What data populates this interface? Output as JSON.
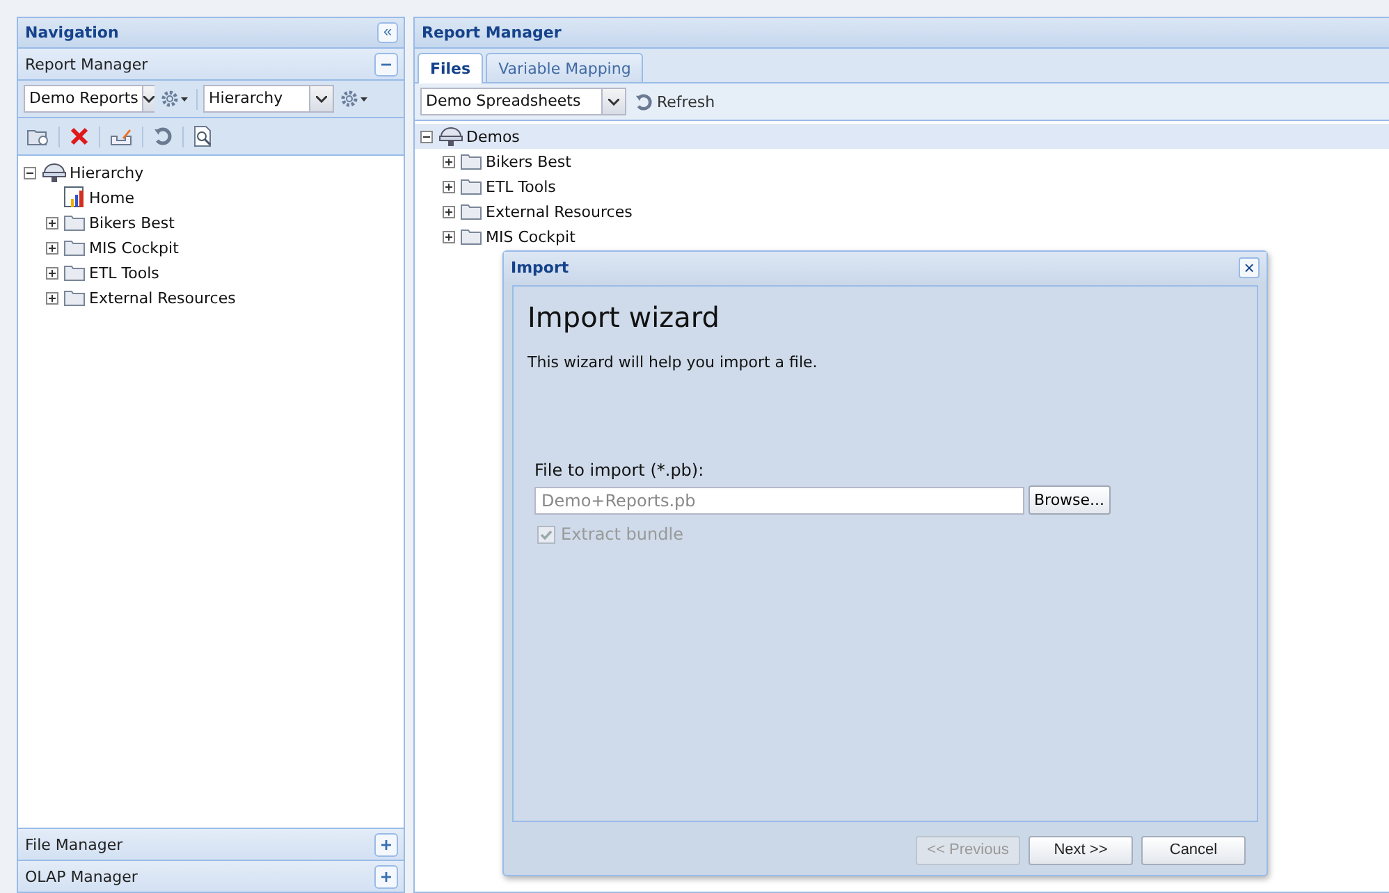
{
  "navigation": {
    "title": "Navigation",
    "collapse_button": "«",
    "sections": [
      {
        "title": "Report Manager",
        "expanded": true
      },
      {
        "title": "File Manager",
        "expanded": false
      },
      {
        "title": "OLAP Manager",
        "expanded": false
      }
    ],
    "report_select": {
      "value": "Demo Reports"
    },
    "view_select": {
      "value": "Hierarchy"
    },
    "tree": [
      {
        "label": "Hierarchy",
        "kind": "root",
        "expanded": true,
        "children": [
          {
            "label": "Home",
            "kind": "report"
          },
          {
            "label": "Bikers Best",
            "kind": "folder",
            "expanded": false
          },
          {
            "label": "MIS Cockpit",
            "kind": "folder",
            "expanded": false
          },
          {
            "label": "ETL Tools",
            "kind": "folder",
            "expanded": false
          },
          {
            "label": "External Resources",
            "kind": "folder",
            "expanded": false
          }
        ]
      }
    ]
  },
  "main": {
    "title": "Report Manager",
    "tabs": [
      {
        "label": "Files",
        "selected": true
      },
      {
        "label": "Variable Mapping",
        "selected": false
      }
    ],
    "group_select": {
      "value": "Demo Spreadsheets"
    },
    "refresh_label": "Refresh",
    "tree": [
      {
        "label": "Demos",
        "kind": "root",
        "expanded": true,
        "selected": true,
        "children": [
          {
            "label": "Bikers Best",
            "kind": "folder",
            "expanded": false
          },
          {
            "label": "ETL Tools",
            "kind": "folder",
            "expanded": false
          },
          {
            "label": "External Resources",
            "kind": "folder",
            "expanded": false
          },
          {
            "label": "MIS Cockpit",
            "kind": "folder",
            "expanded": false
          }
        ]
      }
    ]
  },
  "dialog": {
    "title": "Import",
    "close": "×",
    "heading": "Import wizard",
    "description": "This wizard will help you import a file.",
    "file_label": "File to import (*.pb):",
    "file_placeholder": "Demo+Reports.pb",
    "browse": "Browse...",
    "extract": {
      "label": "Extract bundle",
      "checked": true,
      "disabled": true
    },
    "buttons": [
      {
        "label": "<< Previous",
        "disabled": true
      },
      {
        "label": "Next >>",
        "disabled": false
      },
      {
        "label": "Cancel",
        "disabled": false
      }
    ]
  }
}
